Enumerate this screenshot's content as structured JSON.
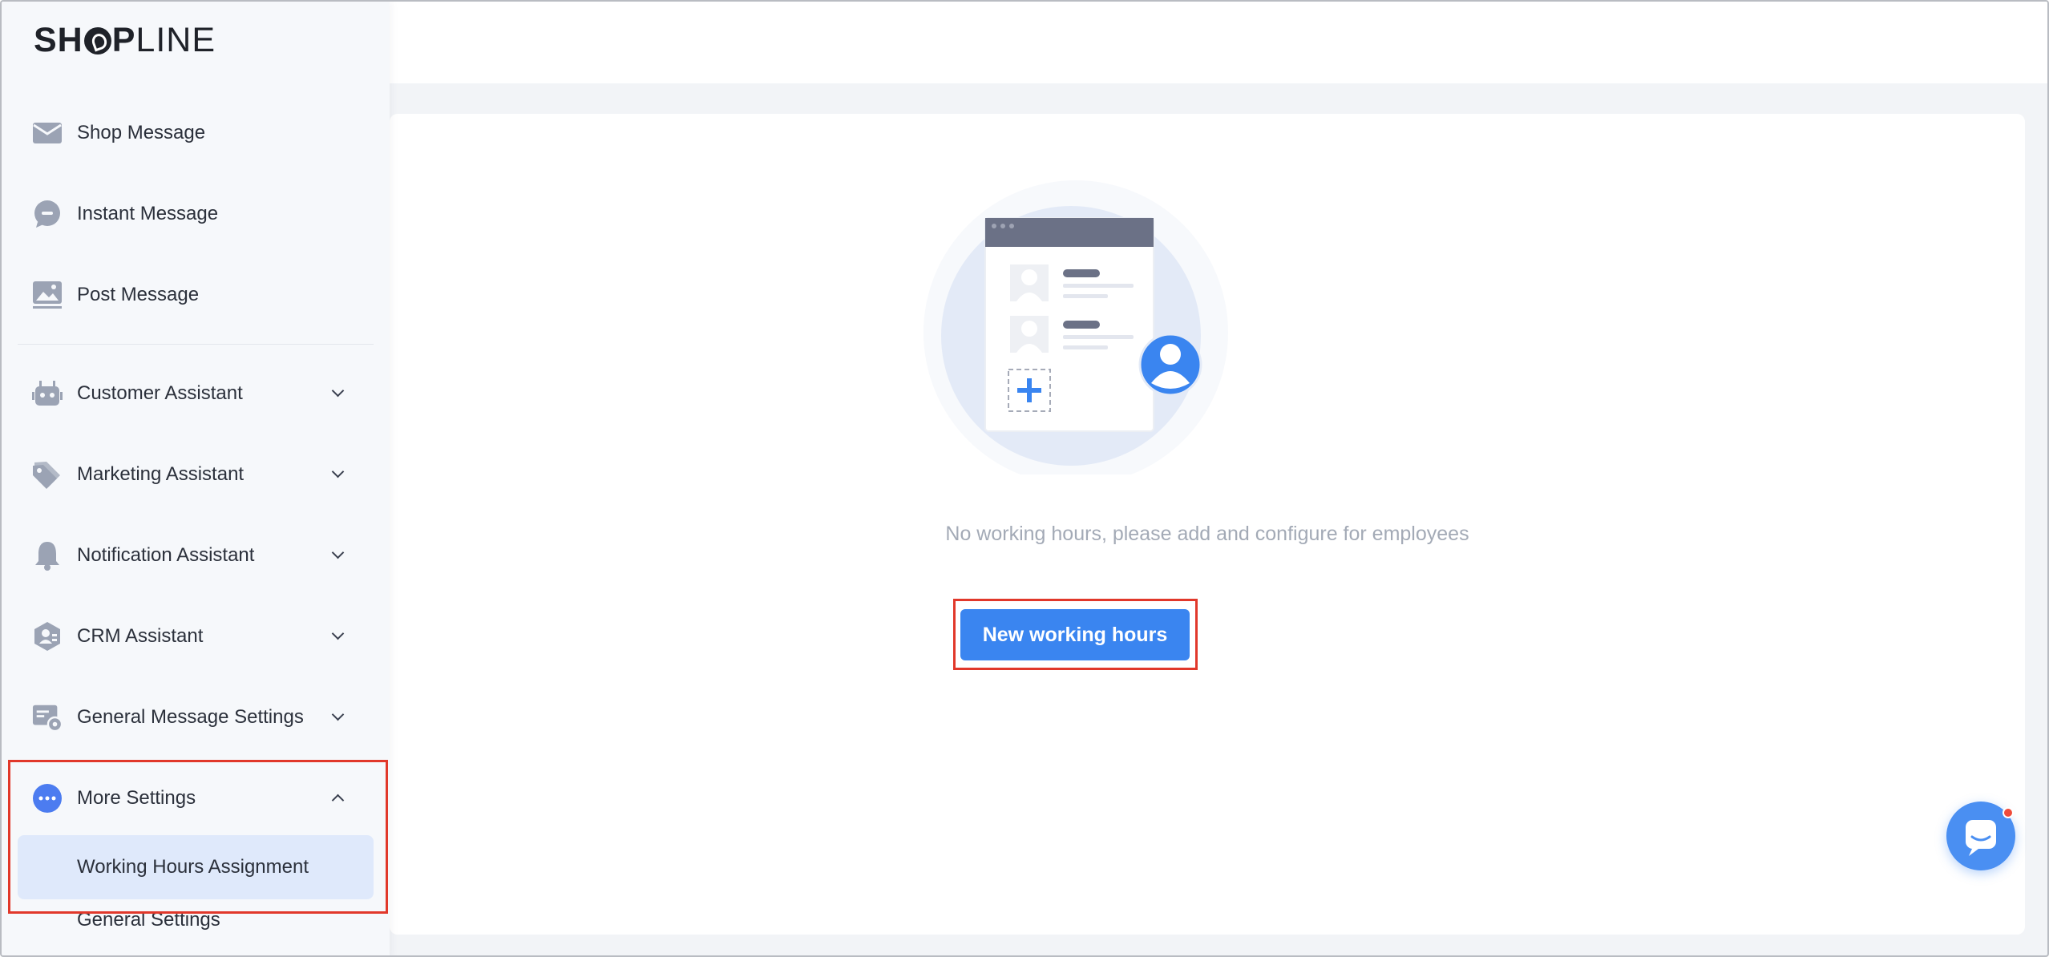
{
  "brand": {
    "logo_prefix": "SH",
    "logo_mid": "P",
    "logo_suffix": "LINE"
  },
  "sidebar": {
    "items": [
      {
        "label": "Shop Message",
        "icon": "envelope-icon"
      },
      {
        "label": "Instant Message",
        "icon": "chat-bubble-icon"
      },
      {
        "label": "Post Message",
        "icon": "image-post-icon"
      },
      {
        "label": "Customer Assistant",
        "icon": "robot-icon",
        "expandable": true
      },
      {
        "label": "Marketing Assistant",
        "icon": "price-tag-icon",
        "expandable": true
      },
      {
        "label": "Notification Assistant",
        "icon": "bell-icon",
        "expandable": true
      },
      {
        "label": "CRM Assistant",
        "icon": "user-hexagon-icon",
        "expandable": true
      },
      {
        "label": "General Message Settings",
        "icon": "message-settings-icon",
        "expandable": true
      },
      {
        "label": "More Settings",
        "icon": "more-dots-icon",
        "expanded": true
      }
    ],
    "sub_items": [
      {
        "label": "Working Hours Assignment",
        "active": true
      },
      {
        "label": "General Settings",
        "active": false
      }
    ]
  },
  "main": {
    "empty_message": "No working hours, please add and configure for employees",
    "cta_label": "New working hours"
  },
  "colors": {
    "accent": "#3a85f0",
    "highlight": "#e1382b",
    "active_bg": "#dfe9fb",
    "icon_gray": "#9ba3b4"
  }
}
